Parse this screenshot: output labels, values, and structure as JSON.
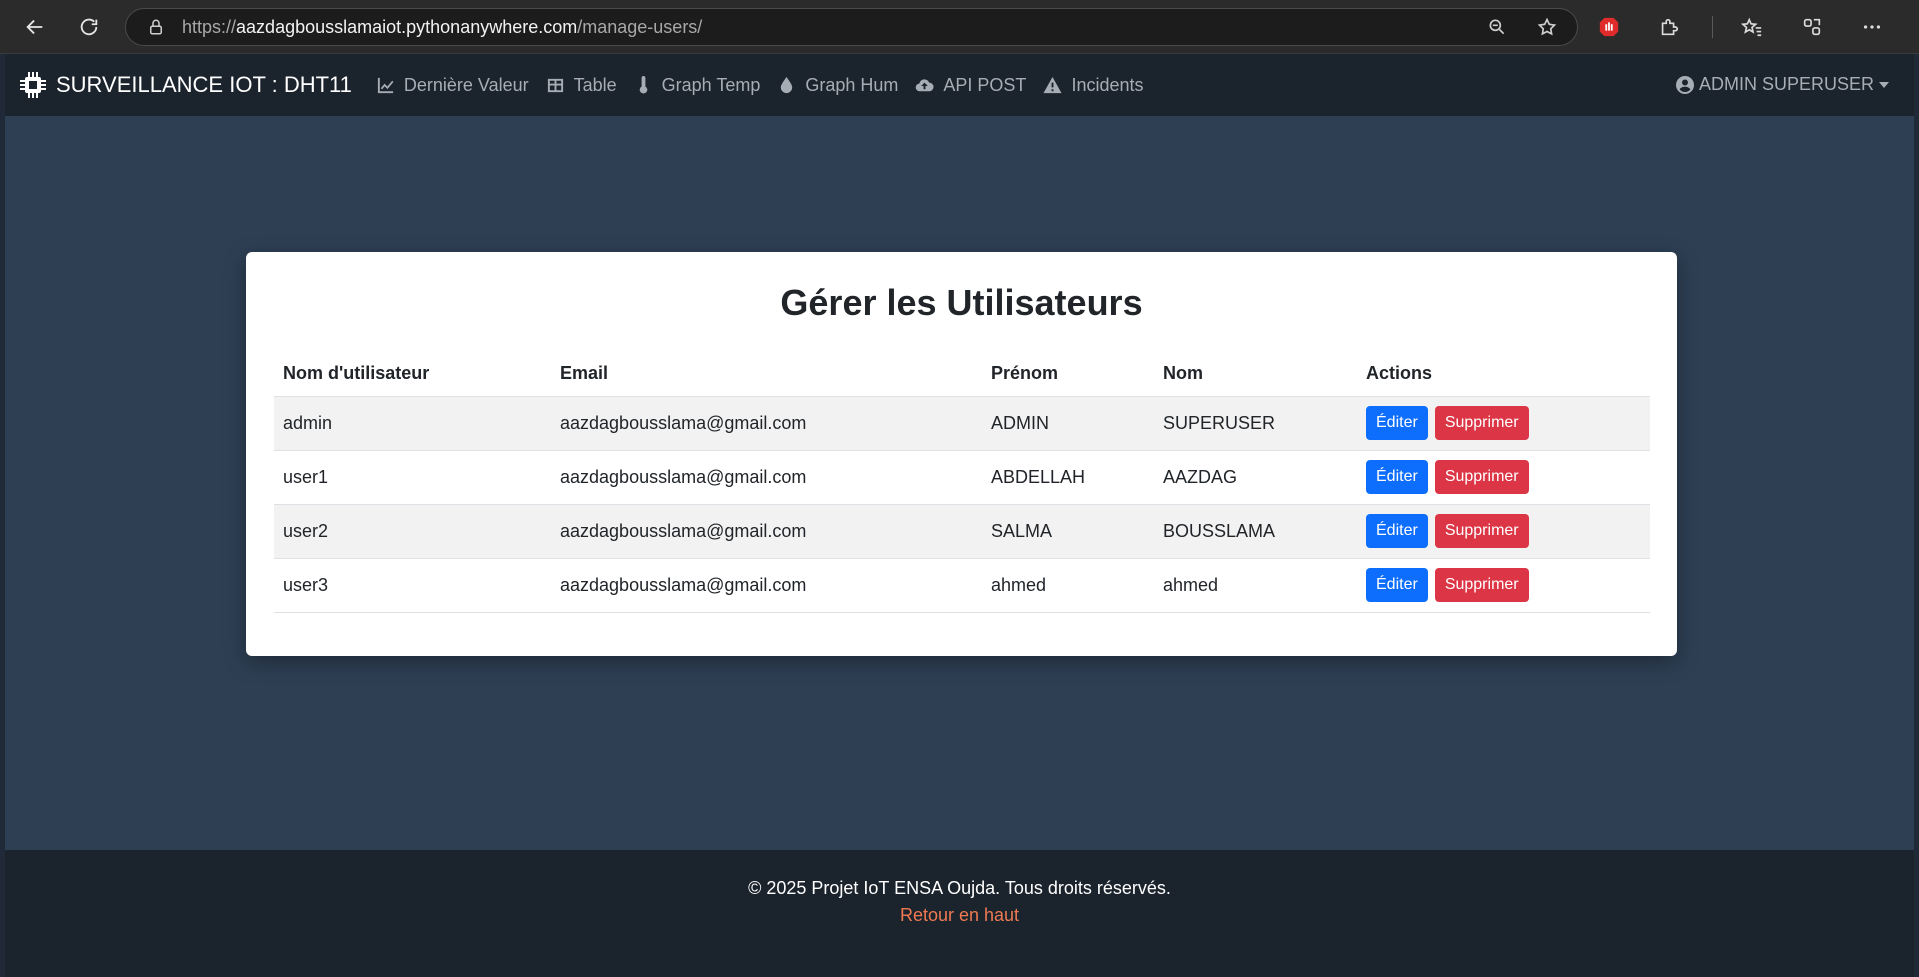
{
  "browser": {
    "url_prefix": "https://",
    "url_host": "aazdagbousslamaiot.pythonanywhere.com",
    "url_path": "/manage-users/"
  },
  "navbar": {
    "brand": "SURVEILLANCE IOT : DHT11",
    "links": [
      {
        "label": "Dernière Valeur",
        "icon": "chart-line-icon"
      },
      {
        "label": "Table",
        "icon": "table-icon"
      },
      {
        "label": "Graph Temp",
        "icon": "thermometer-icon"
      },
      {
        "label": "Graph Hum",
        "icon": "droplet-icon"
      },
      {
        "label": "API POST",
        "icon": "cloud-upload-icon"
      },
      {
        "label": "Incidents",
        "icon": "warning-icon"
      }
    ],
    "user": "ADMIN SUPERUSER"
  },
  "card": {
    "title": "Gérer les Utilisateurs",
    "columns": [
      "Nom d'utilisateur",
      "Email",
      "Prénom",
      "Nom",
      "Actions"
    ],
    "rows": [
      {
        "username": "admin",
        "email": "aazdagbousslama@gmail.com",
        "first_name": "ADMIN",
        "last_name": "SUPERUSER"
      },
      {
        "username": "user1",
        "email": "aazdagbousslama@gmail.com",
        "first_name": "ABDELLAH",
        "last_name": "AAZDAG"
      },
      {
        "username": "user2",
        "email": "aazdagbousslama@gmail.com",
        "first_name": "SALMA",
        "last_name": "BOUSSLAMA"
      },
      {
        "username": "user3",
        "email": "aazdagbousslama@gmail.com",
        "first_name": "ahmed",
        "last_name": "ahmed"
      }
    ],
    "edit_label": "Éditer",
    "delete_label": "Supprimer"
  },
  "footer": {
    "text": "© 2025 Projet IoT ENSA Oujda. Tous droits réservés.",
    "link": "Retour en haut"
  },
  "colors": {
    "navbar_bg": "#1b232c",
    "main_bg": "#2e3f54",
    "edit_button": "#0d6efd",
    "delete_button": "#dc3545",
    "footer_link": "#ef7a52"
  }
}
